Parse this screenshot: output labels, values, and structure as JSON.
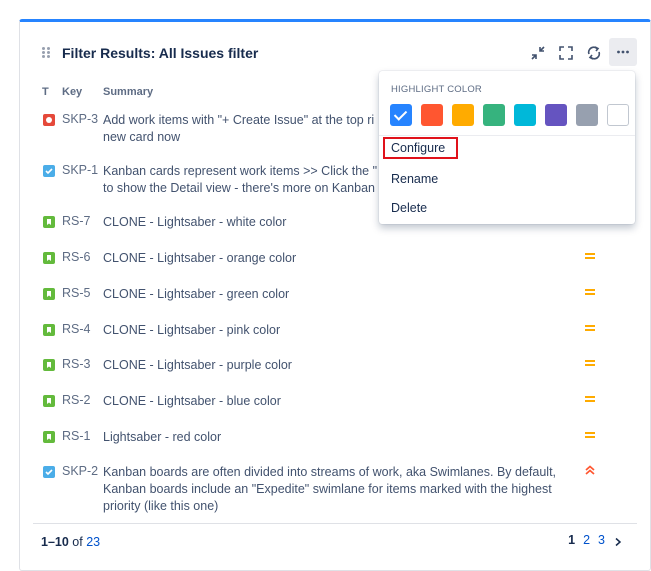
{
  "gadget": {
    "title": "Filter Results: All Issues filter",
    "accent_color": "#2684ff"
  },
  "header_actions": [
    {
      "name": "minimize-icon"
    },
    {
      "name": "maximize-icon"
    },
    {
      "name": "refresh-icon"
    },
    {
      "name": "more-icon"
    }
  ],
  "table": {
    "columns": {
      "type": "T",
      "key": "Key",
      "summary": "Summary"
    },
    "rows": [
      {
        "type": "bug",
        "key": "SKP-3",
        "summary": "Add work items with \"+ Create Issue\" at the top ri… new card now",
        "line1": "Add work items with \"+ Create Issue\" at the top ri",
        "line2": "new card now",
        "priority": ""
      },
      {
        "type": "task",
        "key": "SKP-1",
        "line1": "Kanban cards represent work items >> Click the \"",
        "line2": "to show the Detail view - there's more on Kanban",
        "priority": ""
      },
      {
        "type": "story",
        "key": "RS-7",
        "line1": "CLONE - Lightsaber - white color",
        "line2": "",
        "priority": ""
      },
      {
        "type": "story",
        "key": "RS-6",
        "line1": "CLONE - Lightsaber - orange color",
        "line2": "",
        "priority": "medium"
      },
      {
        "type": "story",
        "key": "RS-5",
        "line1": "CLONE - Lightsaber - green color",
        "line2": "",
        "priority": "medium"
      },
      {
        "type": "story",
        "key": "RS-4",
        "line1": "CLONE - Lightsaber - pink color",
        "line2": "",
        "priority": "medium"
      },
      {
        "type": "story",
        "key": "RS-3",
        "line1": "CLONE - Lightsaber - purple color",
        "line2": "",
        "priority": "medium"
      },
      {
        "type": "story",
        "key": "RS-2",
        "line1": "CLONE - Lightsaber - blue color",
        "line2": "",
        "priority": "medium"
      },
      {
        "type": "story",
        "key": "RS-1",
        "line1": "Lightsaber - red color",
        "line2": "",
        "priority": "medium"
      },
      {
        "type": "task",
        "key": "SKP-2",
        "line1": "Kanban boards are often divided into streams of work, aka Swimlanes. By default,",
        "line2": "Kanban boards include an \"Expedite\" swimlane for items marked with the highest",
        "line3": "priority (like this one)",
        "priority": "highest"
      }
    ]
  },
  "footer": {
    "range": "1–10",
    "of": "of",
    "total": "23",
    "pages": [
      "1",
      "2",
      "3"
    ],
    "current_page": "1"
  },
  "dropdown": {
    "heading": "HIGHLIGHT COLOR",
    "colors": [
      "#2684ff",
      "#ff5630",
      "#ffab00",
      "#36b37e",
      "#00b8d9",
      "#6554c0",
      "#97a0af",
      "#ffffff"
    ],
    "selected_color": "#2684ff",
    "items": [
      "Configure",
      "Rename",
      "Delete"
    ],
    "highlighted_item": "Configure"
  },
  "colors": {
    "priority_medium": "#ffab00",
    "priority_highest": "#ff5630"
  }
}
